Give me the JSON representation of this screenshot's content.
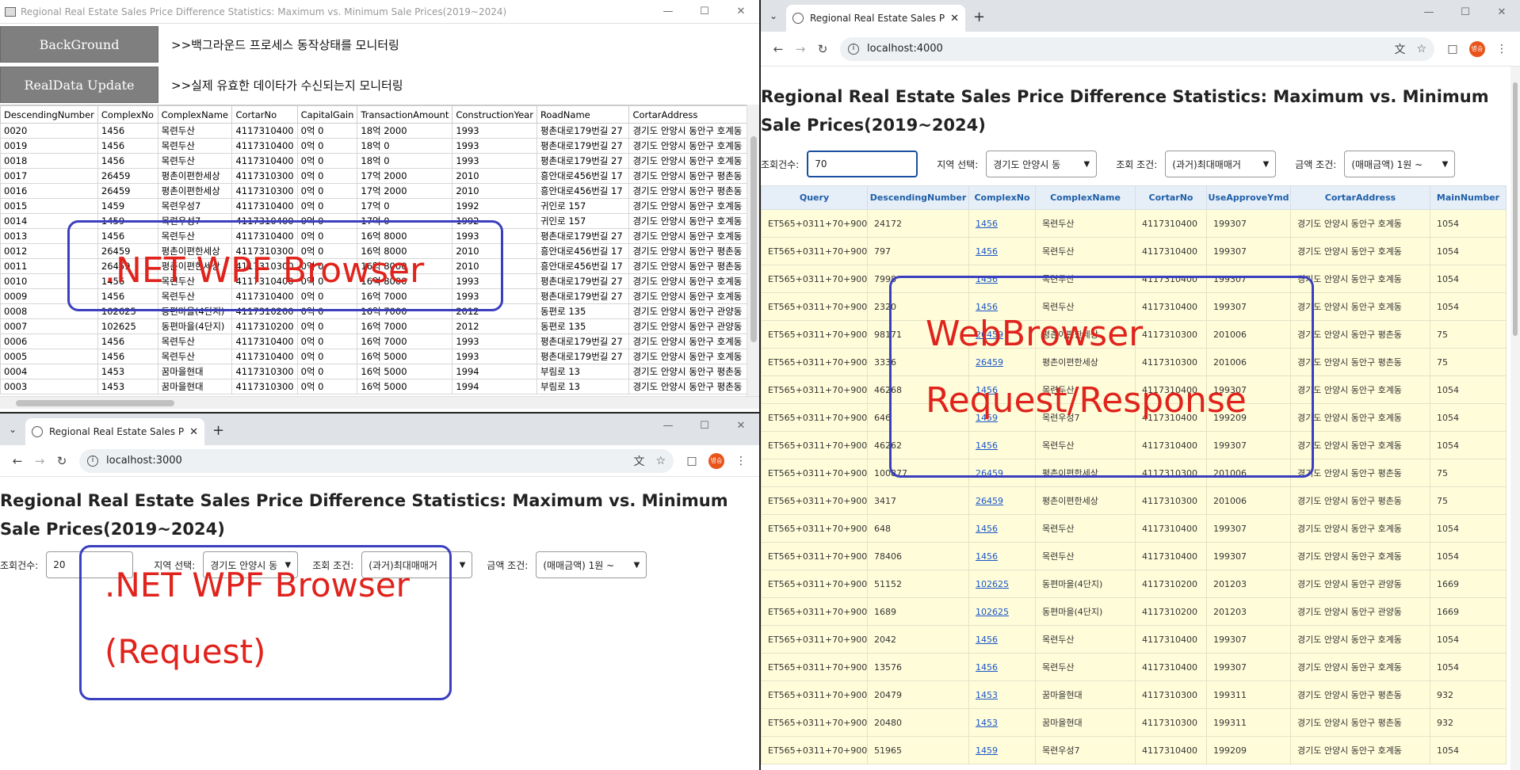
{
  "wpf": {
    "title": "Regional Real Estate Sales Price Difference Statistics: Maximum vs. Minimum Sale Prices(2019~2024)",
    "buttons": [
      {
        "label": "BackGround",
        "desc": ">>백그라운드 프로세스 동작상태를 모니터링"
      },
      {
        "label": "RealData Update",
        "desc": ">>실제 유효한 데이타가 수신되는지 모니터링"
      }
    ],
    "columns": [
      "DescendingNumber",
      "ComplexNo",
      "ComplexName",
      "CortarNo",
      "CapitalGain",
      "TransactionAmount",
      "ConstructionYear",
      "RoadName",
      "CortarAddress"
    ],
    "rows": [
      [
        "0020",
        "1456",
        "목련두산",
        "4117310400",
        "0억 0",
        "18억 2000",
        "1993",
        "평촌대로179번길 27",
        "경기도 안양시 동안구 호계동"
      ],
      [
        "0019",
        "1456",
        "목련두산",
        "4117310400",
        "0억 0",
        "18억 0",
        "1993",
        "평촌대로179번길 27",
        "경기도 안양시 동안구 호계동"
      ],
      [
        "0018",
        "1456",
        "목련두산",
        "4117310400",
        "0억 0",
        "18억 0",
        "1993",
        "평촌대로179번길 27",
        "경기도 안양시 동안구 호계동"
      ],
      [
        "0017",
        "26459",
        "평촌이편한세상",
        "4117310300",
        "0억 0",
        "17억 2000",
        "2010",
        "흥안대로456번길 17",
        "경기도 안양시 동안구 평촌동"
      ],
      [
        "0016",
        "26459",
        "평촌이편한세상",
        "4117310300",
        "0억 0",
        "17억 2000",
        "2010",
        "흥안대로456번길 17",
        "경기도 안양시 동안구 평촌동"
      ],
      [
        "0015",
        "1459",
        "목련우성7",
        "4117310400",
        "0억 0",
        "17억 0",
        "1992",
        "귀인로 157",
        "경기도 안양시 동안구 호계동"
      ],
      [
        "0014",
        "1459",
        "목련우성7",
        "4117310400",
        "0억 0",
        "17억 0",
        "1992",
        "귀인로 157",
        "경기도 안양시 동안구 호계동"
      ],
      [
        "0013",
        "1456",
        "목련두산",
        "4117310400",
        "0억 0",
        "16억 8000",
        "1993",
        "평촌대로179번길 27",
        "경기도 안양시 동안구 호계동"
      ],
      [
        "0012",
        "26459",
        "평촌이편한세상",
        "4117310300",
        "0억 0",
        "16억 8000",
        "2010",
        "흥안대로456번길 17",
        "경기도 안양시 동안구 평촌동"
      ],
      [
        "0011",
        "26459",
        "평촌이편한세상",
        "4117310300",
        "0억 0",
        "16억 8000",
        "2010",
        "흥안대로456번길 17",
        "경기도 안양시 동안구 평촌동"
      ],
      [
        "0010",
        "1456",
        "목련두산",
        "4117310400",
        "0억 0",
        "16억 8000",
        "1993",
        "평촌대로179번길 27",
        "경기도 안양시 동안구 호계동"
      ],
      [
        "0009",
        "1456",
        "목련두산",
        "4117310400",
        "0억 0",
        "16억 7000",
        "1993",
        "평촌대로179번길 27",
        "경기도 안양시 동안구 호계동"
      ],
      [
        "0008",
        "102625",
        "동편마을(4단지)",
        "4117310200",
        "0억 0",
        "16억 7000",
        "2012",
        "동편로 135",
        "경기도 안양시 동안구 관양동"
      ],
      [
        "0007",
        "102625",
        "동편마을(4단지)",
        "4117310200",
        "0억 0",
        "16억 7000",
        "2012",
        "동편로 135",
        "경기도 안양시 동안구 관양동"
      ],
      [
        "0006",
        "1456",
        "목련두산",
        "4117310400",
        "0억 0",
        "16억 7000",
        "1993",
        "평촌대로179번길 27",
        "경기도 안양시 동안구 호계동"
      ],
      [
        "0005",
        "1456",
        "목련두산",
        "4117310400",
        "0억 0",
        "16억 5000",
        "1993",
        "평촌대로179번길 27",
        "경기도 안양시 동안구 호계동"
      ],
      [
        "0004",
        "1453",
        "꿈마을현대",
        "4117310300",
        "0억 0",
        "16억 5000",
        "1994",
        "부림로 13",
        "경기도 안양시 동안구 평촌동"
      ],
      [
        "0003",
        "1453",
        "꿈마을현대",
        "4117310300",
        "0억 0",
        "16억 5000",
        "1994",
        "부림로 13",
        "경기도 안양시 동안구 평촌동"
      ]
    ]
  },
  "chrome_left": {
    "tab_title": "Regional Real Estate Sales Pric",
    "url": "localhost:3000",
    "avatar": "병승",
    "heading": "Regional Real Estate Sales Price Difference Statistics: Maximum vs. Minimum Sale Prices(2019~2024)",
    "count_label": "조회건수:",
    "count_value": "20",
    "region_label": "지역 선택:",
    "region_value": "경기도 안양시 동",
    "cond_label": "조회 조건:",
    "cond_value": "(과거)최대매매거",
    "amount_label": "금액 조건:",
    "amount_value": "(매매금액) 1원 ~"
  },
  "chrome_right": {
    "tab_title": "Regional Real Estate Sales Pric",
    "url": "localhost:4000",
    "avatar": "병승",
    "heading": "Regional Real Estate Sales Price Difference Statistics: Maximum vs. Minimum Sale Prices(2019~2024)",
    "count_label": "조회건수:",
    "count_value": "70",
    "region_label": "지역 선택:",
    "region_value": "경기도 안양시 동",
    "cond_label": "조회 조건:",
    "cond_value": "(과거)최대매매거",
    "amount_label": "금액 조건:",
    "amount_value": "(매매금액) 1원 ~",
    "columns": [
      "Query",
      "DescendingNumber",
      "ComplexNo",
      "ComplexName",
      "CortarNo",
      "UseApproveYmd",
      "CortarAddress",
      "MainNumber"
    ],
    "rows": [
      [
        "ET565+0311+70+900",
        "24172",
        "1456",
        "목련두산",
        "4117310400",
        "199307",
        "경기도 안양시 동안구 호계동",
        "1054"
      ],
      [
        "ET565+0311+70+900",
        "797",
        "1456",
        "목련두산",
        "4117310400",
        "199307",
        "경기도 안양시 동안구 호계동",
        "1054"
      ],
      [
        "ET565+0311+70+900",
        "7998",
        "1456",
        "목련두산",
        "4117310400",
        "199307",
        "경기도 안양시 동안구 호계동",
        "1054"
      ],
      [
        "ET565+0311+70+900",
        "2320",
        "1456",
        "목련두산",
        "4117310400",
        "199307",
        "경기도 안양시 동안구 호계동",
        "1054"
      ],
      [
        "ET565+0311+70+900",
        "98171",
        "26459",
        "평촌이편한세상",
        "4117310300",
        "201006",
        "경기도 안양시 동안구 평촌동",
        "75"
      ],
      [
        "ET565+0311+70+900",
        "3336",
        "26459",
        "평촌이편한세상",
        "4117310300",
        "201006",
        "경기도 안양시 동안구 평촌동",
        "75"
      ],
      [
        "ET565+0311+70+900",
        "46268",
        "1456",
        "목련두산",
        "4117310400",
        "199307",
        "경기도 안양시 동안구 호계동",
        "1054"
      ],
      [
        "ET565+0311+70+900",
        "646",
        "1459",
        "목련우성7",
        "4117310400",
        "199209",
        "경기도 안양시 동안구 호계동",
        "1054"
      ],
      [
        "ET565+0311+70+900",
        "46262",
        "1456",
        "목련두산",
        "4117310400",
        "199307",
        "경기도 안양시 동안구 호계동",
        "1054"
      ],
      [
        "ET565+0311+70+900",
        "100877",
        "26459",
        "평촌이편한세상",
        "4117310300",
        "201006",
        "경기도 안양시 동안구 평촌동",
        "75"
      ],
      [
        "ET565+0311+70+900",
        "3417",
        "26459",
        "평촌이편한세상",
        "4117310300",
        "201006",
        "경기도 안양시 동안구 평촌동",
        "75"
      ],
      [
        "ET565+0311+70+900",
        "648",
        "1456",
        "목련두산",
        "4117310400",
        "199307",
        "경기도 안양시 동안구 호계동",
        "1054"
      ],
      [
        "ET565+0311+70+900",
        "78406",
        "1456",
        "목련두산",
        "4117310400",
        "199307",
        "경기도 안양시 동안구 호계동",
        "1054"
      ],
      [
        "ET565+0311+70+900",
        "51152",
        "102625",
        "동편마을(4단지)",
        "4117310200",
        "201203",
        "경기도 안양시 동안구 관양동",
        "1669"
      ],
      [
        "ET565+0311+70+900",
        "1689",
        "102625",
        "동편마을(4단지)",
        "4117310200",
        "201203",
        "경기도 안양시 동안구 관양동",
        "1669"
      ],
      [
        "ET565+0311+70+900",
        "2042",
        "1456",
        "목련두산",
        "4117310400",
        "199307",
        "경기도 안양시 동안구 호계동",
        "1054"
      ],
      [
        "ET565+0311+70+900",
        "13576",
        "1456",
        "목련두산",
        "4117310400",
        "199307",
        "경기도 안양시 동안구 호계동",
        "1054"
      ],
      [
        "ET565+0311+70+900",
        "20479",
        "1453",
        "꿈마을현대",
        "4117310300",
        "199311",
        "경기도 안양시 동안구 평촌동",
        "932"
      ],
      [
        "ET565+0311+70+900",
        "20480",
        "1453",
        "꿈마을현대",
        "4117310300",
        "199311",
        "경기도 안양시 동안구 평촌동",
        "932"
      ],
      [
        "ET565+0311+70+900",
        "51965",
        "1459",
        "목련우성7",
        "4117310400",
        "199209",
        "경기도 안양시 동안구 호계동",
        "1054"
      ]
    ]
  },
  "annotations": {
    "wpf_browser": ".NET WPF Browser",
    "wpf_request_line1": ".NET WPF Browser",
    "wpf_request_line2": "(Request)",
    "web_line1": "WebBrowser",
    "web_line2": "Request/Response"
  },
  "colors": {
    "annotation_border": "#3a3fbf",
    "annotation_text": "#e0231c",
    "result_row_bg": "#fffdd9",
    "result_header_text": "#1f5fa8"
  }
}
